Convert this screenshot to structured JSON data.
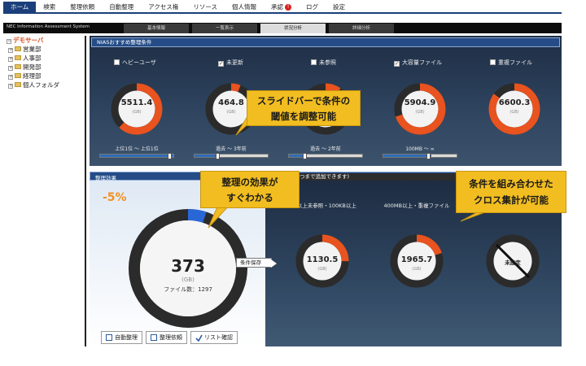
{
  "menu": [
    {
      "label": "ホーム",
      "active": true
    },
    {
      "label": "検索"
    },
    {
      "label": "整理依頼"
    },
    {
      "label": "自動整理"
    },
    {
      "label": "アクセス権"
    },
    {
      "label": "リソース"
    },
    {
      "label": "個人情報"
    },
    {
      "label": "承認",
      "badge": "!"
    },
    {
      "label": "ログ"
    },
    {
      "label": "設定"
    }
  ],
  "header": {
    "system_name": "NEC Information Assessment System",
    "tabs": [
      "基本情報",
      "一覧表示",
      "状況分析",
      "詳細分析"
    ],
    "active_tab": "状況分析"
  },
  "tree": {
    "root": "デモサーバ",
    "items": [
      "営業部",
      "人事部",
      "開発部",
      "経理部",
      "個人フォルダ"
    ]
  },
  "panel1": {
    "title": "NIASおすすめ整理条件",
    "criteria": [
      {
        "label": "ヘビーユーザ",
        "checked": false,
        "value": "5511.4",
        "unit": "(GB)",
        "ratio": 0.62,
        "range": "上位1位 ～ 上位1位",
        "slider_fill": 1.0,
        "knob": 0.96
      },
      {
        "label": "未更新",
        "checked": true,
        "value": "464.8",
        "unit": "(GB)",
        "ratio": 0.06,
        "range": "過去 ～ 3年前",
        "slider_fill": 0.32,
        "knob": 0.3
      },
      {
        "label": "未参照",
        "checked": false,
        "value": "",
        "unit": "",
        "ratio": 0.1,
        "range": "過去 ～ 2年前",
        "slider_fill": 0.22,
        "knob": 0.2
      },
      {
        "label": "大容量ファイル",
        "checked": true,
        "value": "5904.9",
        "unit": "(GB)",
        "ratio": 0.7,
        "range": "100MB ～ ∞",
        "slider_fill": 0.65,
        "knob": 0.62
      },
      {
        "label": "重複ファイル",
        "checked": false,
        "value": "6600.3",
        "unit": "(GB)",
        "ratio": 0.85,
        "range": "",
        "slider_fill": 0,
        "knob": null
      }
    ]
  },
  "panel2": {
    "title": "整理効果",
    "subtitle": "つまで追加できます)",
    "percent": "-5%",
    "total": {
      "value": "373",
      "unit": "(GB)",
      "count_text": "ファイル数：1297",
      "ratio": 0.05
    },
    "save_button": "条件保存",
    "combos": [
      {
        "label": "1年以上未参照・100KB以上",
        "value": "1130.5",
        "unit": "(GB)",
        "ratio": 0.25
      },
      {
        "label": "400MB以上・重複ファイル",
        "value": "1965.7",
        "unit": "(GB)",
        "ratio": 0.2
      },
      {
        "label": "",
        "value": "未設定",
        "unit": "",
        "ratio": 0
      }
    ],
    "buttons": [
      "自動整理",
      "整理依頼",
      "リスト確認"
    ]
  },
  "callouts": {
    "slider": "スライドバーで条件の\n閾値を調整可能",
    "effect": "整理の効果が\nすぐわかる",
    "cross": "条件を組み合わせた\nクロス集計が可能"
  },
  "colors": {
    "accent": "#e8531f",
    "dark_ring": "#2b2b2b",
    "blue_ring": "#2a67d6",
    "callout": "#f2bd20",
    "brand": "#1b3f7a"
  }
}
